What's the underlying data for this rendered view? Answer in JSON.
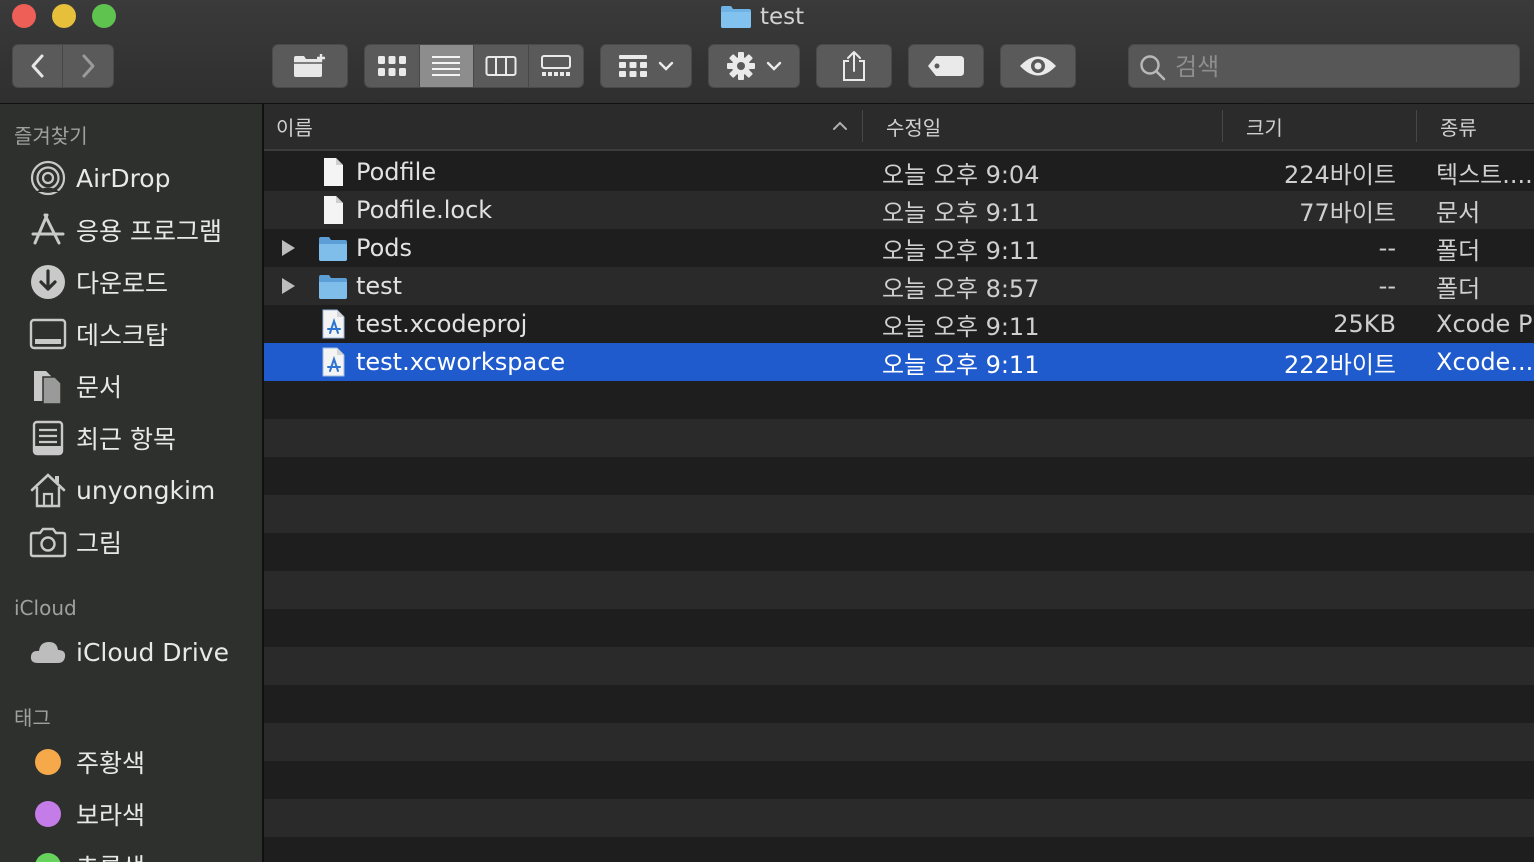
{
  "window": {
    "title": "test",
    "traffic_lights": {
      "close": "#ed5f57",
      "minimize": "#e6bf3b",
      "zoom": "#5fc44f"
    }
  },
  "toolbar": {
    "back_icon": "chevron-left-icon",
    "forward_icon": "chevron-right-icon",
    "new_folder_icon": "new-folder-icon",
    "view_modes": [
      "icon-view",
      "list-view",
      "column-view",
      "gallery-view"
    ],
    "active_view": "list-view",
    "group_icon": "group-grid-icon",
    "action_icon": "gear-icon",
    "share_icon": "share-icon",
    "tag_icon": "tag-icon",
    "quicklook_icon": "eye-icon",
    "search_placeholder": "검색"
  },
  "sidebar": {
    "favorites_header": "즐겨찾기",
    "favorites": [
      {
        "label": "AirDrop",
        "icon": "airdrop-icon"
      },
      {
        "label": "응용 프로그램",
        "icon": "applications-icon"
      },
      {
        "label": "다운로드",
        "icon": "downloads-icon"
      },
      {
        "label": "데스크탑",
        "icon": "desktop-icon"
      },
      {
        "label": "문서",
        "icon": "documents-icon"
      },
      {
        "label": "최근 항목",
        "icon": "recents-icon"
      },
      {
        "label": "unyongkim",
        "icon": "home-icon"
      },
      {
        "label": "그림",
        "icon": "pictures-icon"
      }
    ],
    "icloud_header": "iCloud",
    "icloud": [
      {
        "label": "iCloud Drive",
        "icon": "cloud-icon"
      }
    ],
    "tags_header": "태그",
    "tags": [
      {
        "label": "주황색",
        "color": "#f5a94a"
      },
      {
        "label": "보라색",
        "color": "#c47de8"
      },
      {
        "label": "초록색",
        "color": "#67d35c"
      }
    ]
  },
  "list": {
    "columns": {
      "name": "이름",
      "date": "수정일",
      "size": "크기",
      "kind": "종류"
    },
    "sort_column": "name",
    "rows": [
      {
        "name": "Podfile",
        "date": "오늘 오후 9:04",
        "size": "224바이트",
        "kind": "텍스트....a",
        "type": "file",
        "expandable": false
      },
      {
        "name": "Podfile.lock",
        "date": "오늘 오후 9:11",
        "size": "77바이트",
        "kind": "문서",
        "type": "file",
        "expandable": false
      },
      {
        "name": "Pods",
        "date": "오늘 오후 9:11",
        "size": "--",
        "kind": "폴더",
        "type": "folder",
        "expandable": true
      },
      {
        "name": "test",
        "date": "오늘 오후 8:57",
        "size": "--",
        "kind": "폴더",
        "type": "folder",
        "expandable": true
      },
      {
        "name": "test.xcodeproj",
        "date": "오늘 오후 9:11",
        "size": "25KB",
        "kind": "Xcode Pr",
        "type": "xcode",
        "expandable": false
      },
      {
        "name": "test.xcworkspace",
        "date": "오늘 오후 9:11",
        "size": "222바이트",
        "kind": "Xcode...r",
        "type": "xcode",
        "expandable": false,
        "selected": true
      }
    ]
  },
  "colors": {
    "selection": "#1f5bcc",
    "folder": "#6fb3e6"
  }
}
